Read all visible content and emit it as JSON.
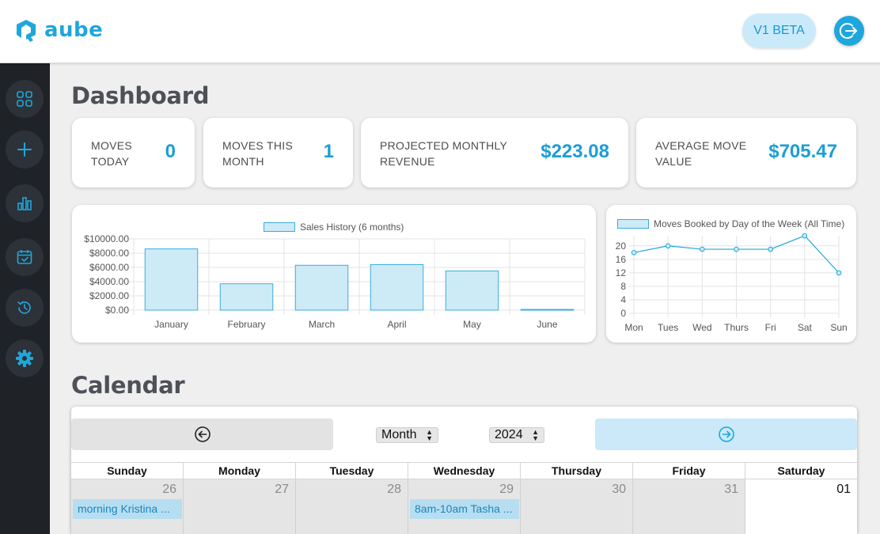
{
  "header": {
    "brand": "aube",
    "beta_label": "V1 BETA",
    "logout_icon": "logout-icon",
    "accent_color": "#1ea7dc"
  },
  "sidebar": {
    "items": [
      {
        "name": "dashboard",
        "icon": "grid-icon"
      },
      {
        "name": "add",
        "icon": "plus-icon"
      },
      {
        "name": "reports",
        "icon": "bar-chart-icon"
      },
      {
        "name": "schedule",
        "icon": "calendar-check-icon"
      },
      {
        "name": "history",
        "icon": "history-icon"
      },
      {
        "name": "settings",
        "icon": "gear-icon"
      }
    ]
  },
  "dashboard": {
    "title": "Dashboard",
    "stats": [
      {
        "label_line1": "MOVES",
        "label_line2": "TODAY",
        "value": "0"
      },
      {
        "label_line1": "MOVES THIS",
        "label_line2": "MONTH",
        "value": "1"
      },
      {
        "label_line1": "PROJECTED MONTHLY",
        "label_line2": "REVENUE",
        "value": "$223.08"
      },
      {
        "label_line1": "AVERAGE MOVE",
        "label_line2": "VALUE",
        "value": "$705.47"
      }
    ]
  },
  "chart_data": [
    {
      "type": "bar",
      "title": "",
      "categories": [
        "January",
        "February",
        "March",
        "April",
        "May",
        "June"
      ],
      "series": [
        {
          "name": "Sales History (6 months)",
          "values": [
            8600,
            3700,
            6300,
            6400,
            5500,
            100
          ]
        }
      ],
      "ylim": [
        0,
        10000
      ],
      "yticks": [
        "$0.00",
        "$2000.00",
        "$4000.00",
        "$6000.00",
        "$8000.00",
        "$10000.00"
      ],
      "xlabel": "",
      "ylabel": "",
      "grid": true,
      "legend": "top",
      "color": "#3aaddc"
    },
    {
      "type": "line",
      "title": "",
      "categories": [
        "Mon",
        "Tues",
        "Wed",
        "Thurs",
        "Fri",
        "Sat",
        "Sun"
      ],
      "series": [
        {
          "name": "Moves Booked by Day of the Week (All Time)",
          "values": [
            18,
            20,
            19,
            19,
            19,
            23,
            12
          ]
        }
      ],
      "ylim": [
        0,
        23
      ],
      "yticks": [
        "0",
        "4",
        "8",
        "12",
        "16",
        "20"
      ],
      "xlabel": "",
      "ylabel": "",
      "grid": true,
      "legend": "top",
      "color": "#1ea7dc"
    }
  ],
  "calendar": {
    "title": "Calendar",
    "prev_icon": "arrow-left-circle-icon",
    "next_icon": "arrow-right-circle-icon",
    "view_select": "Month",
    "year_select": "2024",
    "weekdays": [
      "Sunday",
      "Monday",
      "Tuesday",
      "Wednesday",
      "Thursday",
      "Friday",
      "Saturday"
    ],
    "week": [
      {
        "date": "26",
        "event": "morning Kristina ..."
      },
      {
        "date": "27",
        "event": ""
      },
      {
        "date": "28",
        "event": ""
      },
      {
        "date": "29",
        "event": "8am-10am Tasha ..."
      },
      {
        "date": "30",
        "event": ""
      },
      {
        "date": "31",
        "event": ""
      },
      {
        "date": "01",
        "event": ""
      }
    ]
  }
}
